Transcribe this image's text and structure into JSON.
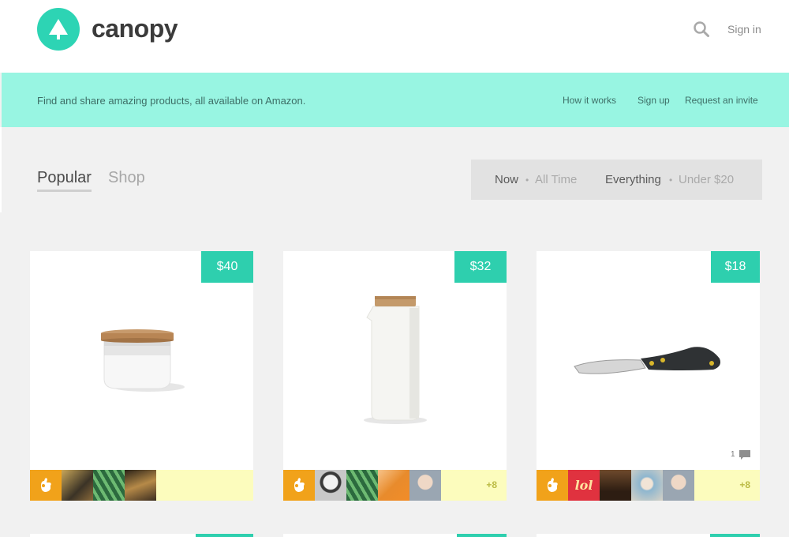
{
  "header": {
    "brand": "canopy",
    "logo_icon": "tree-icon",
    "search_icon": "search-icon",
    "signin": "Sign in"
  },
  "banner": {
    "text": "Find and share amazing products, all available on Amazon.",
    "links": [
      "How it works",
      "Sign up",
      "Request an invite"
    ]
  },
  "tabs": [
    "Popular",
    "Shop"
  ],
  "filters": {
    "time": [
      "Now",
      "All Time"
    ],
    "price": [
      "Everything",
      "Under $20"
    ],
    "separator": "•"
  },
  "products": [
    {
      "price": "$40",
      "more": "",
      "comments": ""
    },
    {
      "price": "$32",
      "more": "+8",
      "comments": ""
    },
    {
      "price": "$18",
      "more": "+8",
      "comments": "1"
    }
  ],
  "avatar_badge": "lol",
  "colors": {
    "brand": "#2dd4b4",
    "banner": "#98f5e2",
    "price": "#2ecfae",
    "hand": "#f1a21a",
    "card_footer": "#fcfcbd"
  }
}
